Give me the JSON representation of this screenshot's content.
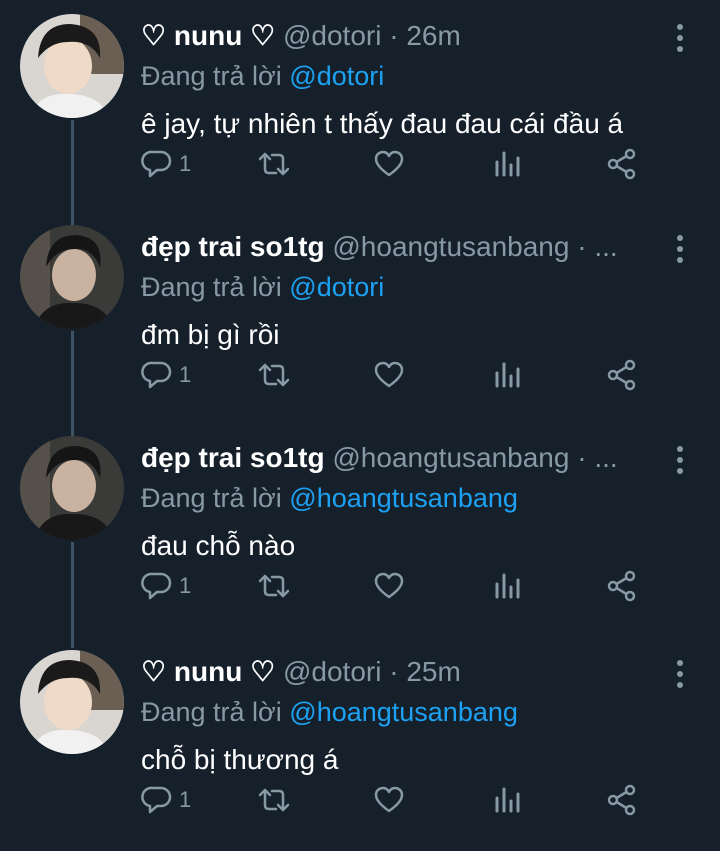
{
  "tweets": [
    {
      "name": "♡ nunu ♡",
      "handle": "@dotori",
      "separator": "·",
      "time": "26m",
      "reply_prefix": "Đang trả lời",
      "reply_to": "@dotori",
      "text": "ê jay, tự nhiên t thấy đau đau cái đầu á",
      "reply_count": "1",
      "avatar": "avatar-light"
    },
    {
      "name": "đẹp trai so1tg",
      "handle": "@hoangtusanbang",
      "separator": "·",
      "time": "...",
      "reply_prefix": "Đang trả lời",
      "reply_to": "@dotori",
      "text": "đm bị gì rồi",
      "reply_count": "1",
      "avatar": "avatar-dark"
    },
    {
      "name": "đẹp trai so1tg",
      "handle": "@hoangtusanbang",
      "separator": "·",
      "time": "...",
      "reply_prefix": "Đang trả lời",
      "reply_to": "@hoangtusanbang",
      "text": "đau chỗ nào",
      "reply_count": "1",
      "avatar": "avatar-dark"
    },
    {
      "name": "♡ nunu ♡",
      "handle": "@dotori",
      "separator": "·",
      "time": "25m",
      "reply_prefix": "Đang trả lời",
      "reply_to": "@hoangtusanbang",
      "text": "chỗ bị thương á",
      "reply_count": "1",
      "avatar": "avatar-light"
    }
  ],
  "icons": {
    "reply": "reply-icon",
    "retweet": "retweet-icon",
    "like": "heart-icon",
    "analytics": "analytics-icon",
    "share": "share-icon",
    "more": "more-vertical-icon"
  },
  "colors": {
    "background": "#15202b",
    "muted": "#8899a6",
    "link": "#1da1f2",
    "thread_line": "#3d5466"
  }
}
